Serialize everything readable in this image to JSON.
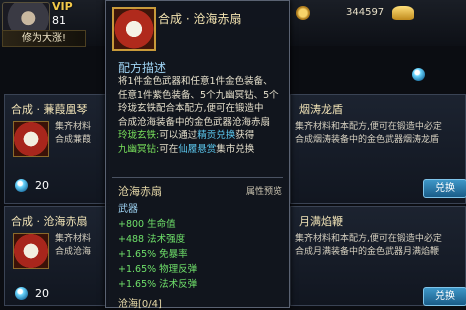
{
  "header": {
    "vip": "VIP",
    "level": "81",
    "tip": "修为大涨!",
    "copper": "344597"
  },
  "cards": [
    {
      "title": "合成 · 蒹葭凰琴",
      "desc1": "集齐材料",
      "desc2": "合成蒹葭",
      "count": "20"
    },
    {
      "title": "合成 · 沧海赤扇",
      "desc1": "集齐材料",
      "desc2": "合成沧海",
      "count": "20"
    },
    {
      "title": "烟涛龙盾",
      "desc1": "集齐材料和本配方,便可在锻造中必定",
      "desc2": "合成烟涛装备中的金色武器烟涛龙盾",
      "button": "兑换"
    },
    {
      "title": "月满焰鞭",
      "desc1": "集齐材料和本配方,便可在锻造中必定",
      "desc2": "合成月满装备中的金色武器月满焰鞭",
      "button": "兑换"
    }
  ],
  "tooltip": {
    "title": "合成 · 沧海赤扇",
    "section": "配方描述",
    "line1": "将1件金色武器和任意1件金色装备、",
    "line2": "任意1件紫色装备、5个九幽冥钻、5个",
    "line3": "玲珑玄铁配合本配方,便可在锻造中",
    "line4": "合成沧海装备中的金色武器沧海赤扇",
    "line5a": "玲珑玄铁:",
    "line5b": "可以通过",
    "line5c": "精贡兑换",
    "line5d": "获得",
    "line6a": "九幽冥钻:",
    "line6b": "可在",
    "line6c": "仙履悬赏",
    "line6d": "集市兑换",
    "item": "沧海赤扇",
    "preview": "属性预览",
    "weapon": "武器",
    "stats": [
      "+800 生命值",
      "+488 法术强度",
      "+1.65% 免暴率",
      "+1.65% 物理反弹",
      "+1.65% 法术反弹"
    ],
    "footer": "沧海[0/4]"
  }
}
